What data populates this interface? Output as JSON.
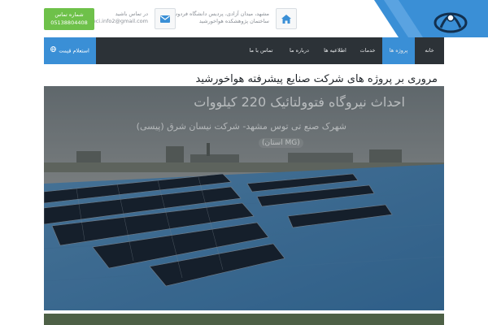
{
  "header": {
    "address_line1": "مشهد، میدان آزادی، پردیس دانشگاه فردوسی مشهد",
    "address_line2": "ساختمان پژوهشکده هواخورشید",
    "email_label": "در تماس باشید",
    "email": "saeci.info2@gmail.com",
    "phone_label": "شماره تماس",
    "phone": "05138804408",
    "icons": {
      "home": "home-icon",
      "email": "envelope-icon"
    },
    "colors": {
      "brand": "#3a8fd6",
      "phone_button": "#6ec14a"
    }
  },
  "nav": {
    "items": [
      {
        "label": "خانه",
        "active": false
      },
      {
        "label": "پروژه ها",
        "active": true
      },
      {
        "label": "خدمات",
        "active": false
      },
      {
        "label": "اطلاعیه ها",
        "active": false
      },
      {
        "label": "درباره ما",
        "active": false
      },
      {
        "label": "تماس با ما",
        "active": false
      }
    ],
    "quote_button": "استعلام قیمت",
    "colors": {
      "bar": "#2c3237",
      "active": "#3a8fd6"
    }
  },
  "main": {
    "heading": "مروری بر پروژه های شرکت صنایع پیشرفته هواخورشید",
    "slide": {
      "title": "احداث نیروگاه فتوولتائیک 220 کیلووات",
      "subtitle": "شهرک صنع  تی توس مشهد- شرکت نیسان شرق (پیسی)",
      "pill": "(استان MG)"
    }
  }
}
